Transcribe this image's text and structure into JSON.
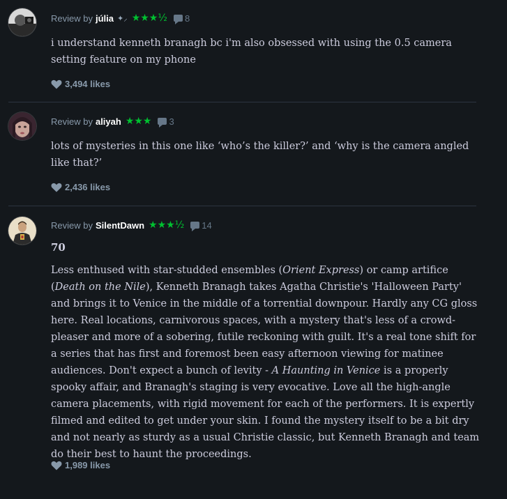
{
  "reviews": [
    {
      "by_label": "Review by",
      "author": "júlia",
      "emoji": "✦⸝",
      "rating": "★★★½",
      "comments": "8",
      "text": "i understand kenneth branagh bc i'm also obsessed with using the 0.5 camera setting feature on my phone",
      "likes": "3,494 likes"
    },
    {
      "by_label": "Review by",
      "author": "aliyah",
      "rating": "★★★",
      "comments": "3",
      "text": "lots of mysteries in this one like ‘who’s the killer?’ and ‘why is the camera angled like that?’",
      "likes": "2,436 likes"
    },
    {
      "by_label": "Review by",
      "author": "SilentDawn",
      "rating": "★★★½",
      "comments": "14",
      "score": "70",
      "text_parts": {
        "p1": "Less enthused with star-studded ensembles (",
        "i1": "Orient Express",
        "p2": ") or camp artifice (",
        "i2": "Death on the Nile",
        "p3": "), Kenneth Branagh takes Agatha Christie's 'Halloween Party' and brings it to Venice in the middle of a torrential downpour. Hardly any CG gloss here. Real locations, carnivorous spaces, with a mystery that's less of a crowd-pleaser and more of a sobering, futile reckoning with guilt. It's a real tone shift for a series that has first and foremost been easy afternoon viewing for matinee audiences. Don't expect a bunch of levity - ",
        "i3": "A Haunting in Venice",
        "p4": " is a properly spooky affair, and Branagh's staging is very evocative. Love all the high-angle camera placements, with rigid movement for each of the performers. It is expertly filmed and edited to get under your skin. I found the mystery itself to be a bit dry and not nearly as sturdy as a usual Christie classic, but Kenneth Branagh and team do their best to haunt the proceedings."
      },
      "likes": "1,989 likes"
    }
  ],
  "colors": {
    "background": "#14181c",
    "star_green": "#00c030",
    "author_white": "#ffffff",
    "meta_gray": "#8899aa",
    "body_text": "#ccccdd",
    "divider": "#2c3440"
  }
}
